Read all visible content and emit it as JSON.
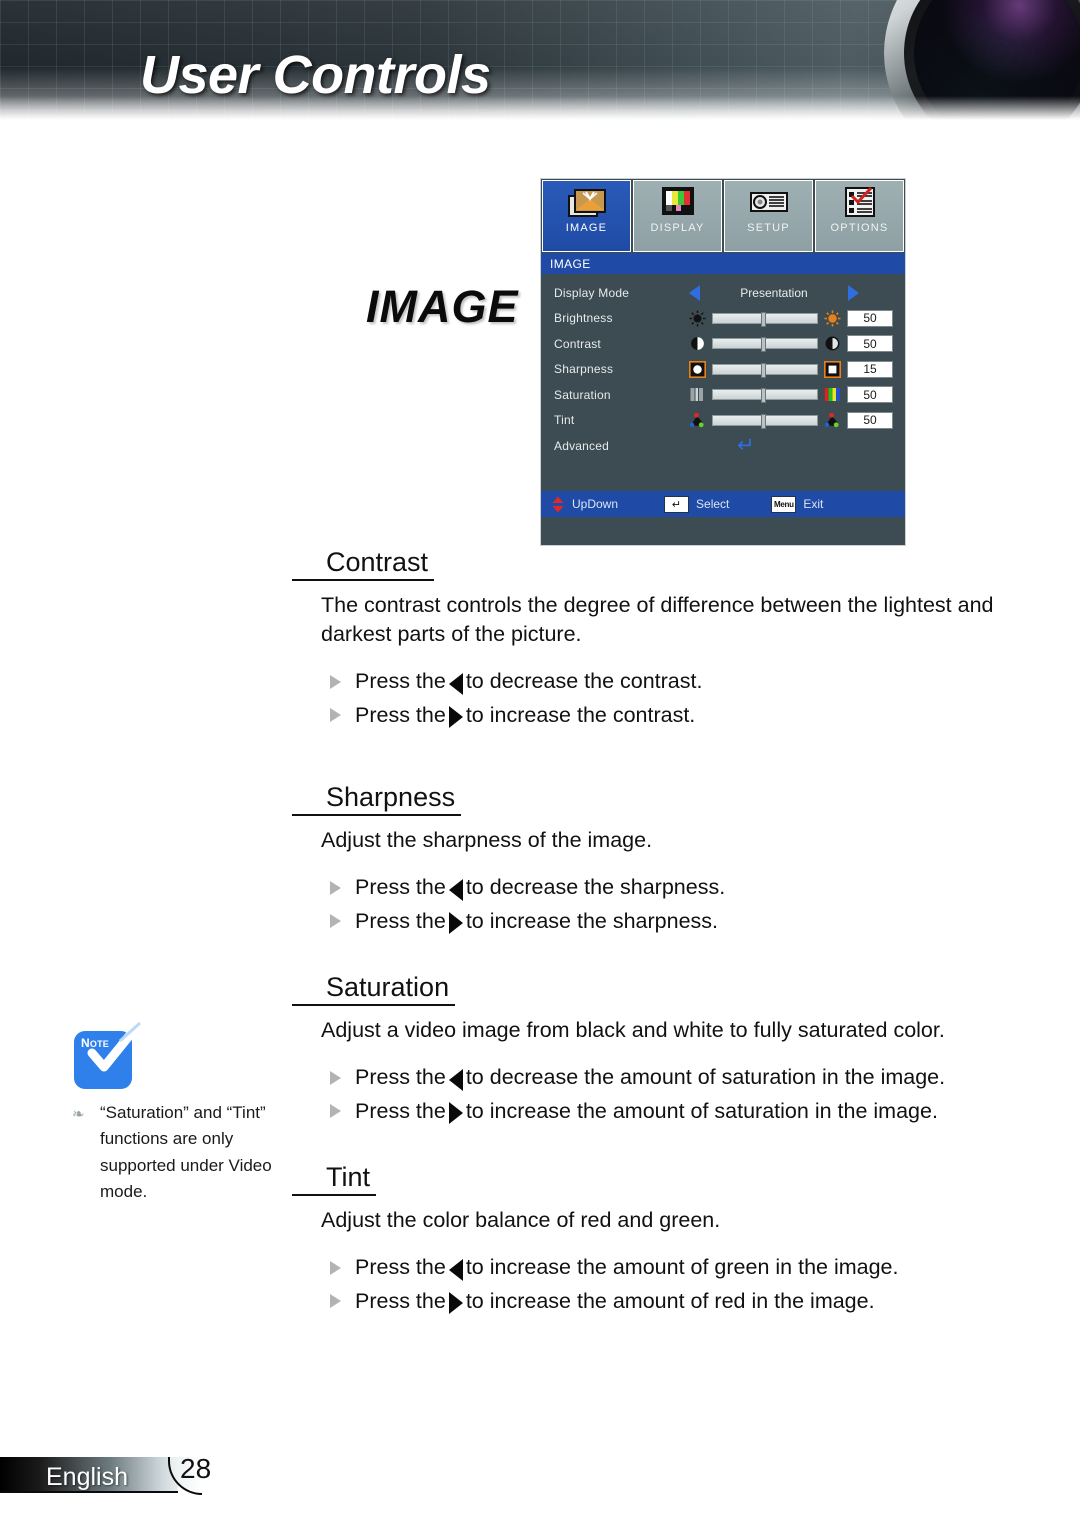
{
  "header": {
    "title": "User Controls",
    "lens_icon": "camera-lens-graphic"
  },
  "section_label": "IMAGE",
  "osd": {
    "tabs": [
      {
        "label": "IMAGE",
        "icon": "image-tab-icon",
        "active": true
      },
      {
        "label": "DISPLAY",
        "icon": "display-tab-icon",
        "active": false
      },
      {
        "label": "SETUP",
        "icon": "setup-tab-icon",
        "active": false
      },
      {
        "label": "OPTIONS",
        "icon": "options-tab-icon",
        "active": false
      }
    ],
    "title_bar": "IMAGE",
    "rows": {
      "display_mode": {
        "label": "Display Mode",
        "value": "Presentation",
        "left_arrow": "left-arrow-icon",
        "right_arrow": "right-arrow-icon"
      },
      "brightness": {
        "label": "Brightness",
        "value": "50",
        "min_icon": "brightness-low-icon",
        "max_icon": "brightness-high-icon"
      },
      "contrast": {
        "label": "Contrast",
        "value": "50",
        "min_icon": "contrast-low-icon",
        "max_icon": "contrast-high-icon"
      },
      "sharpness": {
        "label": "Sharpness",
        "value": "15",
        "min_icon": "sharpness-low-icon",
        "max_icon": "sharpness-high-icon"
      },
      "saturation": {
        "label": "Saturation",
        "value": "50",
        "min_icon": "saturation-low-icon",
        "max_icon": "saturation-high-icon"
      },
      "tint": {
        "label": "Tint",
        "value": "50",
        "min_icon": "tint-low-icon",
        "max_icon": "tint-high-icon"
      },
      "advanced": {
        "label": "Advanced",
        "enter_icon": "enter-arrow-icon"
      }
    },
    "footer": {
      "updown_label": "UpDown",
      "updown_icon": "up-down-arrows-icon",
      "select_label": "Select",
      "select_key": "↵",
      "exit_label": "Exit",
      "exit_key": "Menu"
    },
    "colors": {
      "accent_blue": "#1f4ba6",
      "panel_bg": "#3c4c52",
      "tab_inactive": "#9fb0b3"
    }
  },
  "sections": [
    {
      "title": "Contrast",
      "body": "The contrast controls the degree of difference between the lightest and darkest parts of the picture.",
      "bullets": [
        {
          "pre": "Press the",
          "arrow": "left",
          "post": "to decrease the contrast."
        },
        {
          "pre": "Press the",
          "arrow": "right",
          "post": "to increase the contrast."
        }
      ]
    },
    {
      "title": "Sharpness",
      "body": "Adjust the sharpness of the image.",
      "bullets": [
        {
          "pre": "Press the",
          "arrow": "left",
          "post": "to decrease the sharpness."
        },
        {
          "pre": "Press the",
          "arrow": "right",
          "post": "to increase the sharpness."
        }
      ]
    },
    {
      "title": "Saturation",
      "body": "Adjust a video image from black and white to fully saturated color.",
      "bullets": [
        {
          "pre": "Press the",
          "arrow": "left",
          "post": "to decrease the amount of saturation in the image."
        },
        {
          "pre": "Press the",
          "arrow": "right",
          "post": "to increase the amount of saturation in the image."
        }
      ]
    },
    {
      "title": "Tint",
      "body": "Adjust the color balance of red and green.",
      "bullets": [
        {
          "pre": "Press the",
          "arrow": "left",
          "post": "to increase the amount of green in the image."
        },
        {
          "pre": "Press the",
          "arrow": "right",
          "post": "to increase the amount of red in the image."
        }
      ]
    }
  ],
  "note": {
    "badge_text": "NOTE",
    "badge_icon": "note-checkmark-icon",
    "text": "“Saturation” and “Tint” functions are only supported under Video mode."
  },
  "footer": {
    "language": "English",
    "page_number": "28"
  }
}
